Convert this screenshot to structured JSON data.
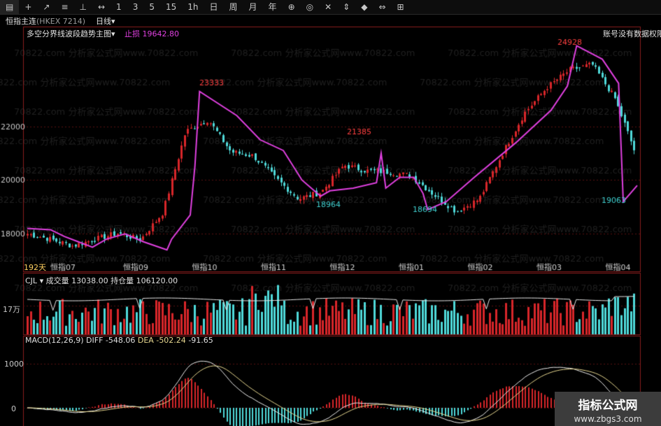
{
  "toolbar": {
    "items": [
      "▤",
      "+",
      "↗",
      "≡",
      "⊥",
      "↔",
      "1",
      "3",
      "5",
      "15",
      "1h",
      "日",
      "周",
      "月",
      "年",
      "⊕",
      "◎",
      "✕",
      "⇕",
      "◆",
      "⇔",
      "⊞"
    ]
  },
  "title": {
    "name": "恒指主连",
    "code": "(HKEX 7214)",
    "period": "日线",
    "period_arrow": "▾"
  },
  "main": {
    "indicator_name": "多空分界线波段趋势主图",
    "dropdown": "▾",
    "stop_label": "止损",
    "stop_value": "19642.80",
    "note": "账号没有数据权限",
    "days": "192天"
  },
  "watermark": "70822.com 分析家公式网www.70822.com",
  "volume": {
    "name": "CJL",
    "vol_label": "成交量",
    "vol_value": "13038.00",
    "oi_label": "持仓量",
    "oi_value": "106120.00",
    "axis_label": "17万"
  },
  "macd": {
    "name": "MACD(12,26,9)",
    "diff_label": "DIFF",
    "diff_value": "-548.06",
    "dea_label": "DEA",
    "dea_value": "-502.24",
    "macd_value": "-91.65",
    "axis_1000": "1000",
    "axis_0": "0"
  },
  "brand": {
    "title": "指标公式网",
    "url": "www.zbgs3.com"
  },
  "colors": {
    "up": "#d8262a",
    "down": "#4fd9d9",
    "trend": "#e040e0",
    "label": "#ff4040",
    "low_label": "#40d0d0",
    "diff": "#f0f0f0",
    "dea": "#e8d890"
  },
  "chart_data": {
    "type": "candlestick",
    "y_ticks": [
      22000,
      20000,
      18000
    ],
    "x_labels": [
      "恒指09",
      "恒指10",
      "恒指11",
      "恒指12",
      "恒指01",
      "恒指02",
      "恒指03",
      "恒指04"
    ],
    "annotations": [
      {
        "text": "23333",
        "kind": "high",
        "value": 23333
      },
      {
        "text": "21385",
        "kind": "high",
        "value": 21385
      },
      {
        "text": "24928",
        "kind": "high",
        "value": 24928
      },
      {
        "text": "18964",
        "kind": "low",
        "value": 18964
      },
      {
        "text": "18694",
        "kind": "low",
        "value": 18694
      },
      {
        "text": "19063",
        "kind": "low",
        "value": 19063
      },
      {
        "text": "恒指07",
        "kind": "start",
        "value": 17480
      }
    ],
    "ohlc_anchors": [
      [
        18100,
        17900
      ],
      [
        17900,
        17700
      ],
      [
        17600,
        17500
      ],
      [
        17700,
        17900
      ],
      [
        18000,
        18050
      ],
      [
        17800,
        17750
      ],
      [
        18100,
        19500
      ],
      [
        20500,
        23100
      ],
      [
        23300,
        21200
      ],
      [
        21000,
        21100
      ],
      [
        20800,
        21000
      ],
      [
        20400,
        19700
      ],
      [
        19500,
        19100
      ],
      [
        19400,
        19700
      ],
      [
        20000,
        21100
      ],
      [
        20800,
        19900
      ],
      [
        20200,
        20400
      ],
      [
        20200,
        20100
      ],
      [
        19700,
        19200
      ],
      [
        18900,
        18750
      ],
      [
        19000,
        19600
      ],
      [
        20200,
        21700
      ],
      [
        22200,
        22800
      ],
      [
        23600,
        23300
      ],
      [
        23700,
        24500
      ],
      [
        24700,
        23900
      ],
      [
        23400,
        22700
      ],
      [
        20600,
        21000
      ]
    ]
  }
}
